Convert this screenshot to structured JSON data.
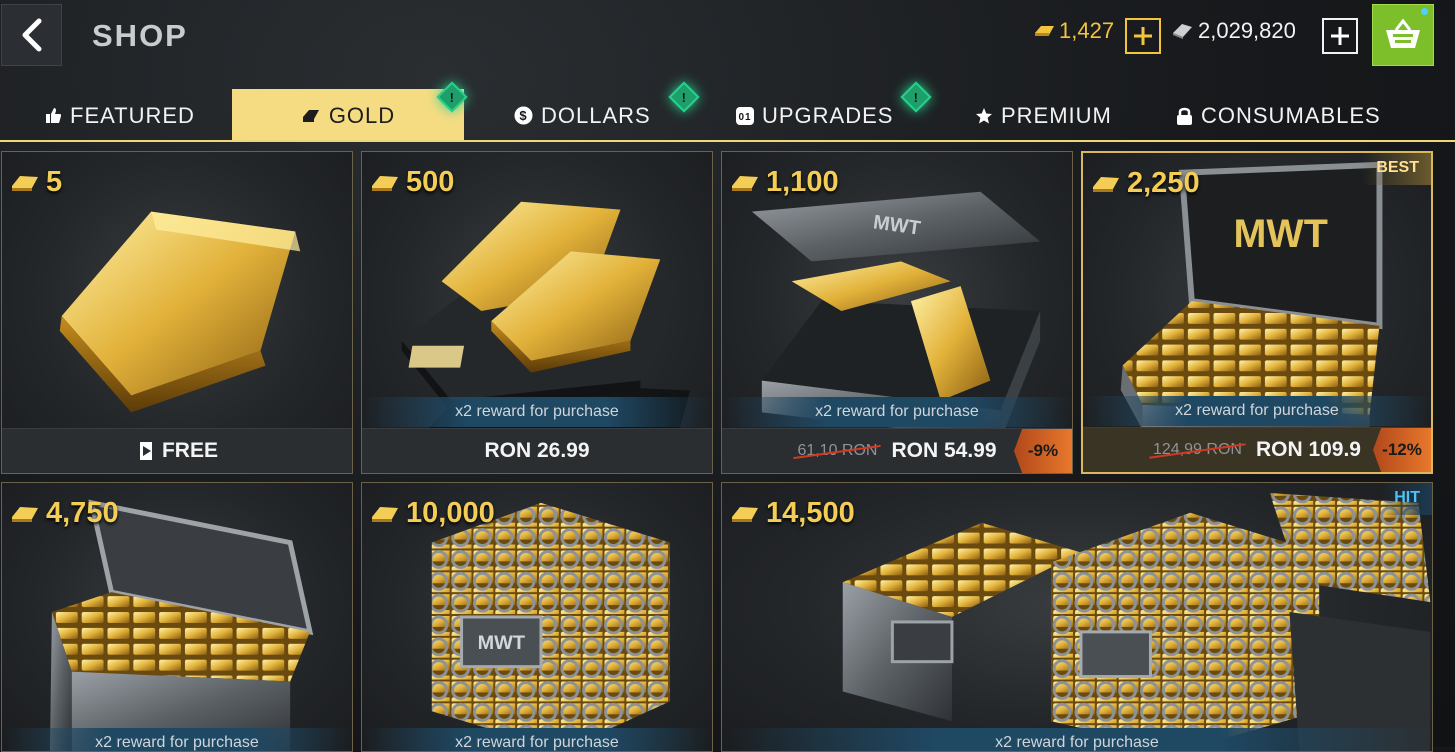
{
  "header": {
    "title": "SHOP",
    "gold_balance": "1,427",
    "dollar_balance": "2,029,820"
  },
  "tabs": [
    {
      "label": "FEATURED",
      "icon": "thumbs-up-icon"
    },
    {
      "label": "GOLD",
      "icon": "gold-bar-icon",
      "active": true
    },
    {
      "label": "DOLLARS",
      "icon": "dollar-coin-icon"
    },
    {
      "label": "UPGRADES",
      "icon": "upgrade-icon"
    },
    {
      "label": "PREMIUM",
      "icon": "star-icon"
    },
    {
      "label": "CONSUMABLES",
      "icon": "lock-icon"
    }
  ],
  "alert_symbol": "!",
  "offers": [
    {
      "amount": "5",
      "price": "FREE",
      "price_icon": "video-ad-icon"
    },
    {
      "amount": "500",
      "reward": "x2 reward for purchase",
      "price": "RON 26.99"
    },
    {
      "amount": "1,100",
      "reward": "x2 reward for purchase",
      "old_price": "61,10 RON",
      "price": "RON 54.99",
      "discount": "-9%"
    },
    {
      "amount": "2,250",
      "badge": "BEST",
      "reward": "x2 reward for purchase",
      "old_price": "124,99 RON",
      "price": "RON 109.9",
      "discount": "-12%"
    },
    {
      "amount": "4,750",
      "reward": "x2 reward for purchase"
    },
    {
      "amount": "10,000",
      "reward": "x2 reward for purchase"
    },
    {
      "amount": "14,500",
      "badge": "HIT",
      "reward": "x2 reward for purchase"
    }
  ],
  "colors": {
    "gold": "#f3cd55",
    "active_tab": "#f5dc83",
    "basket": "#7dbf2a",
    "alert": "#27d08d",
    "discount": "#e8782c"
  }
}
